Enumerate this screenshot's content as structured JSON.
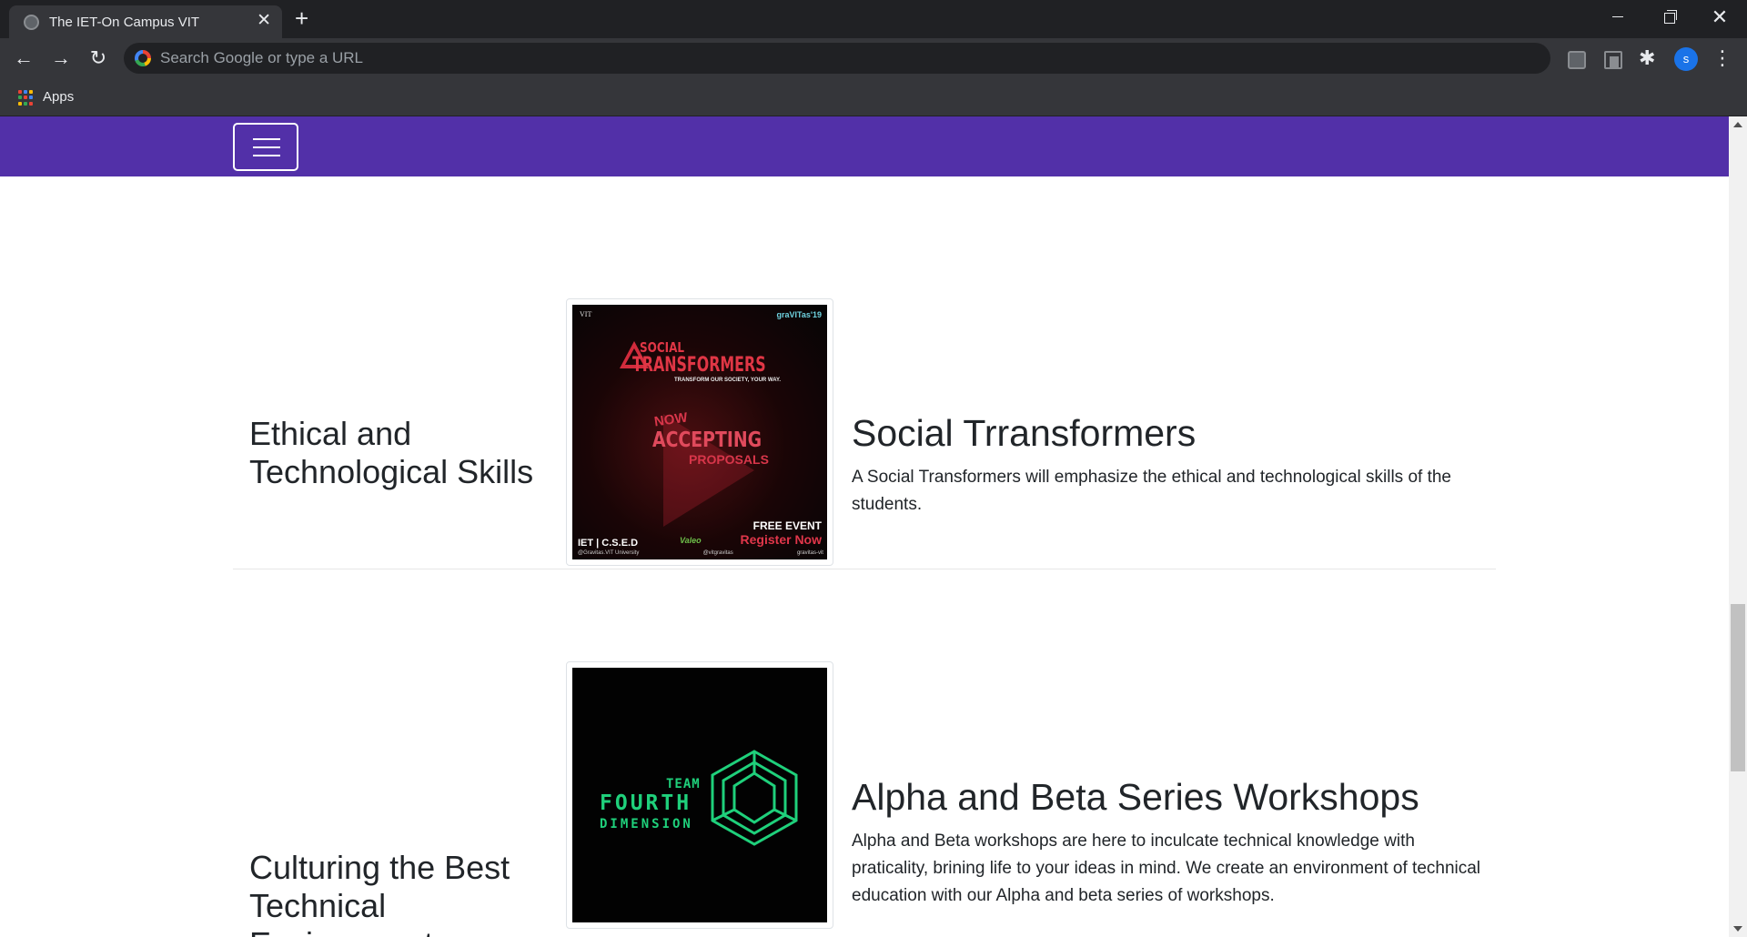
{
  "browser": {
    "tab_title": "The IET-On Campus VIT",
    "new_tab_icon": "plus-icon",
    "omnibox_placeholder": "Search Google or type a URL",
    "bookmarks": [
      {
        "label": "Apps"
      }
    ],
    "profile_initial": "s"
  },
  "sections": [
    {
      "side_heading": "Ethical and Technological Skills",
      "title": "Social Trransformers",
      "description": "A Social Transformers will emphasize the ethical and technological skills of the students.",
      "poster": {
        "top_left": "VIT",
        "top_right": "graVITas'19",
        "title_line1": "SOCIAL",
        "title_line2": "TRANSFORMERS",
        "subtitle": "TRANSFORM OUR SOCIETY, YOUR WAY.",
        "now": "NOW",
        "accepting": "ACCEPTING",
        "proposals": "PROPOSALS",
        "free_event": "FREE EVENT",
        "register": "Register Now",
        "org": "IET | C.S.E.D",
        "sponsor": "Valeo",
        "footer_left": "@Gravitas.VIT University",
        "footer_mid": "@vitgravitas",
        "footer_right": "gravitas-vit"
      }
    },
    {
      "side_heading": "Culturing the Best Technical Environment",
      "title": "Alpha and Beta Series Workshops",
      "description": "Alpha and Beta workshops are here to inculcate technical knowledge with praticality, brining life to your ideas in mind. We create an environment of technical education with our Alpha and beta series of workshops.",
      "poster": {
        "team": "TEAM",
        "fourth": "FOURTH",
        "dimension": "DIMENSION"
      }
    }
  ],
  "colors": {
    "navbar": "#5230a8",
    "chrome_dark": "#202124",
    "chrome_toolbar": "#35363a",
    "accent_green": "#1fd07b",
    "accent_red": "#e03645"
  }
}
